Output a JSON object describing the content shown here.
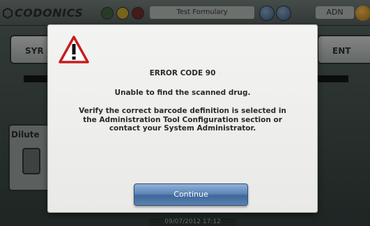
{
  "header": {
    "brand": "CODONICS",
    "formulary": "Test Formulary",
    "user": "ADN"
  },
  "background": {
    "left_tab_label": "SYR",
    "right_tab_label": "ENT",
    "dilute_label": "Dilute",
    "datetime": "09/07/2012 17:12"
  },
  "dialog": {
    "icon": "warning-triangle-icon",
    "error_code": "ERROR CODE 90",
    "message": "Unable to find the scanned drug.",
    "detail": "Verify the correct barcode definition is selected in the Administration Tool Configuration section or contact your System Administrator.",
    "continue_label": "Continue"
  },
  "colors": {
    "status_light_1": "#3f5a3c",
    "status_light_2": "#b99a2a",
    "status_light_3": "#6b2a24",
    "warning_red": "#c41e1e",
    "button_blue": "#4f77a8"
  }
}
